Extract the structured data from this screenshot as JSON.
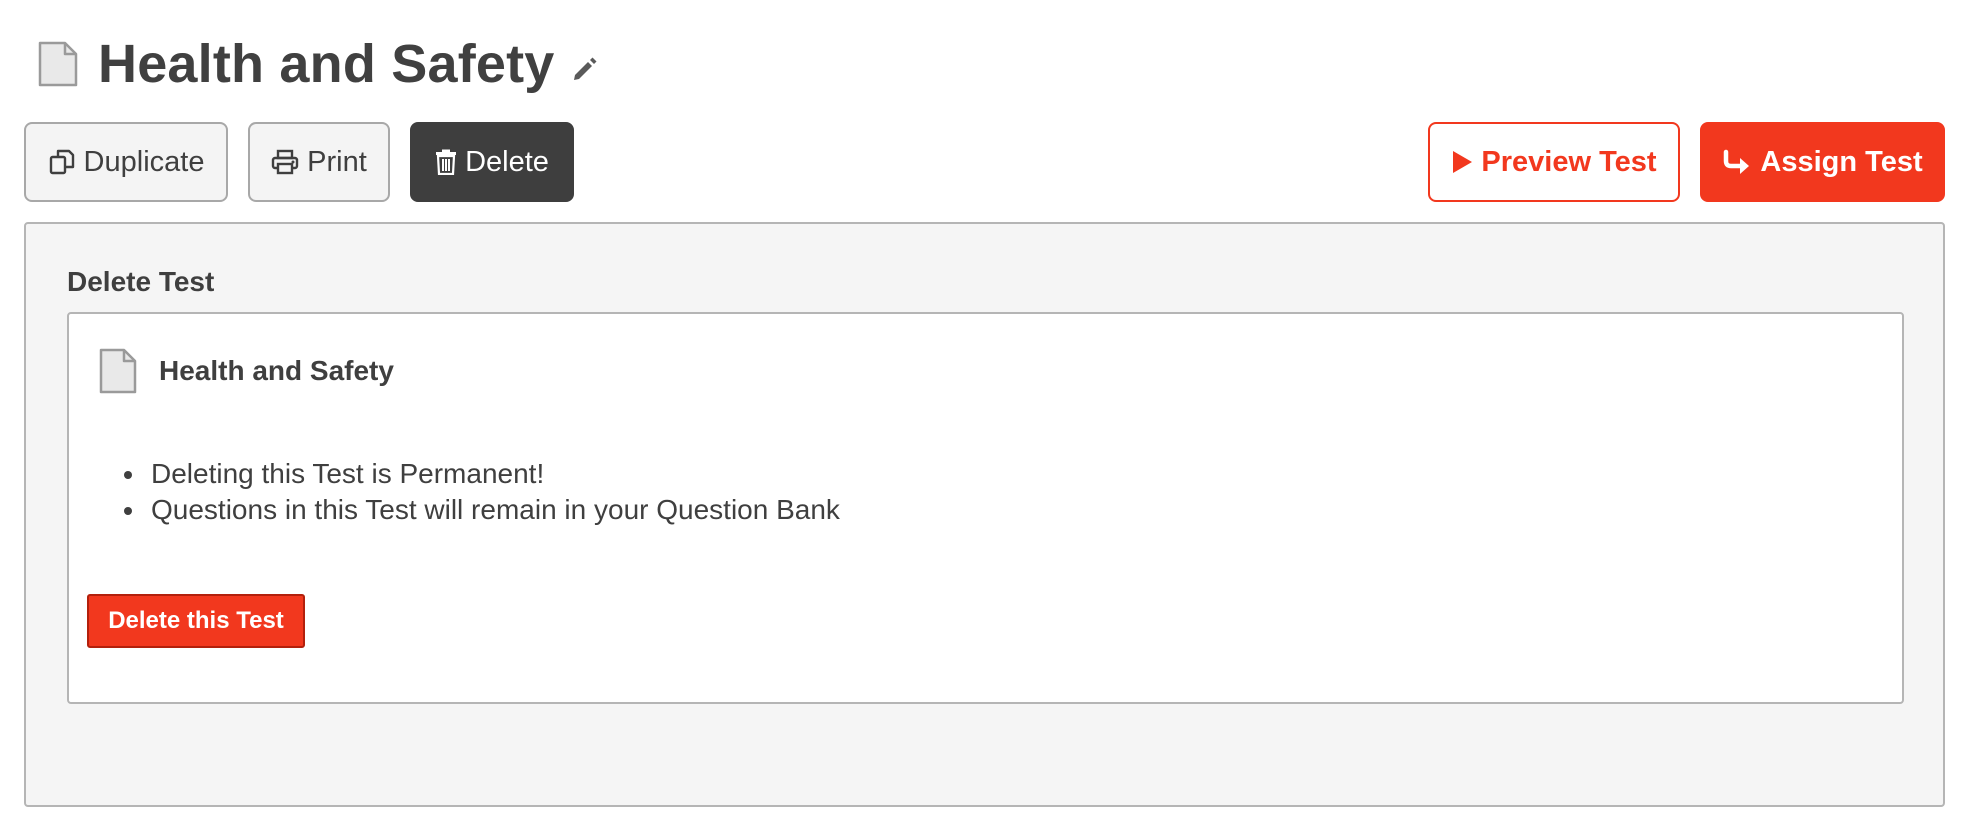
{
  "header": {
    "title": "Health and Safety",
    "doc_icon": "document-icon",
    "edit_icon": "pencil-icon"
  },
  "toolbar": {
    "duplicate_label": "Duplicate",
    "duplicate_icon": "copy-icon",
    "print_label": "Print",
    "print_icon": "printer-icon",
    "delete_label": "Delete",
    "delete_icon": "trash-icon",
    "preview_label": "Preview Test",
    "preview_icon": "play-icon",
    "assign_label": "Assign Test",
    "assign_icon": "share-arrow-icon"
  },
  "delete_panel": {
    "heading": "Delete Test",
    "item_title": "Health and Safety",
    "item_icon": "document-icon",
    "warnings": [
      "Deleting this Test is Permanent!",
      "Questions in this Test will remain in your Question Bank"
    ],
    "confirm_label": "Delete this Test"
  },
  "colors": {
    "accent_red": "#f2381e",
    "dark_button": "#3e3e3e",
    "panel_bg": "#f5f5f5",
    "text": "#3f3f3f"
  }
}
